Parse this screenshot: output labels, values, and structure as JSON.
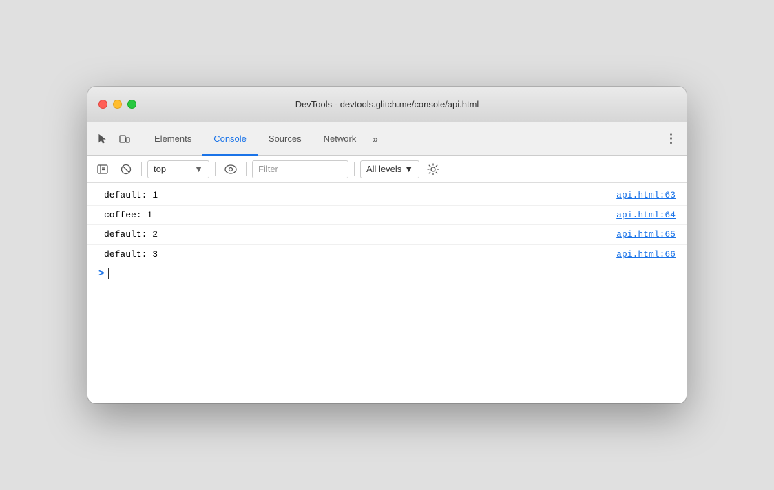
{
  "window": {
    "title": "DevTools - devtools.glitch.me/console/api.html"
  },
  "trafficLights": {
    "close": "close",
    "minimize": "minimize",
    "maximize": "maximize"
  },
  "tabs": [
    {
      "id": "elements",
      "label": "Elements",
      "active": false
    },
    {
      "id": "console",
      "label": "Console",
      "active": true
    },
    {
      "id": "sources",
      "label": "Sources",
      "active": false
    },
    {
      "id": "network",
      "label": "Network",
      "active": false
    }
  ],
  "tabMore": "»",
  "menuDots": "⋮",
  "consoleToolbar": {
    "contextValue": "top",
    "contextArrow": "▼",
    "filterPlaceholder": "Filter",
    "levelsLabel": "All levels",
    "levelsArrow": "▼"
  },
  "consoleRows": [
    {
      "text": "default: 1",
      "link": "api.html:63"
    },
    {
      "text": "coffee: 1",
      "link": "api.html:64"
    },
    {
      "text": "default: 2",
      "link": "api.html:65"
    },
    {
      "text": "default: 3",
      "link": "api.html:66"
    }
  ],
  "consolePrompt": ">"
}
